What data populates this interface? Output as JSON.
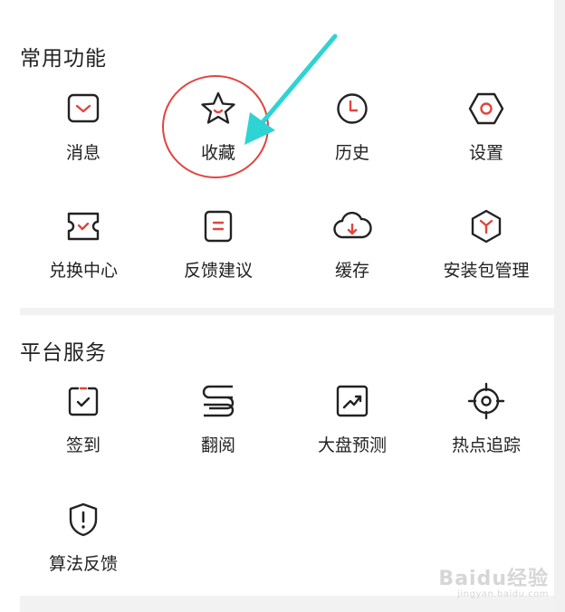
{
  "sections": [
    {
      "title": "常用功能",
      "items": [
        {
          "label": "消息",
          "icon": "message-icon"
        },
        {
          "label": "收藏",
          "icon": "star-icon"
        },
        {
          "label": "历史",
          "icon": "clock-icon"
        },
        {
          "label": "设置",
          "icon": "hexagon-settings-icon"
        },
        {
          "label": "兑换中心",
          "icon": "ticket-icon"
        },
        {
          "label": "反馈建议",
          "icon": "feedback-icon"
        },
        {
          "label": "缓存",
          "icon": "cloud-download-icon"
        },
        {
          "label": "安装包管理",
          "icon": "package-icon"
        }
      ]
    },
    {
      "title": "平台服务",
      "items": [
        {
          "label": "签到",
          "icon": "checkin-icon"
        },
        {
          "label": "翻阅",
          "icon": "reading-icon"
        },
        {
          "label": "大盘预测",
          "icon": "trend-chart-icon"
        },
        {
          "label": "热点追踪",
          "icon": "target-icon"
        },
        {
          "label": "算法反馈",
          "icon": "shield-alert-icon"
        }
      ]
    }
  ],
  "watermark": {
    "main": "Baidu经验",
    "sub": "jingyan.baidu.com"
  },
  "colors": {
    "accent": "#e0453f",
    "annotation_arrow": "#2fd3d3",
    "icon_stroke": "#222222",
    "background": "#ffffff",
    "separator": "#f2f2f2"
  }
}
